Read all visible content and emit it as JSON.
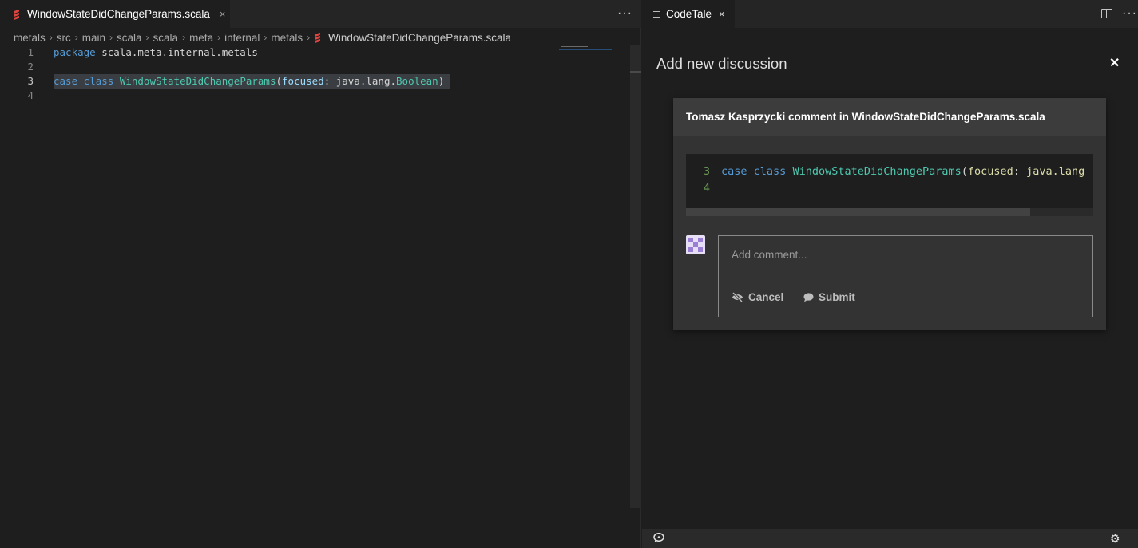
{
  "editor": {
    "tab": {
      "label": "WindowStateDidChangeParams.scala",
      "close_glyph": "×"
    },
    "more_glyph": "···",
    "breadcrumb": [
      "metals",
      "src",
      "main",
      "scala",
      "scala",
      "meta",
      "internal",
      "metals"
    ],
    "breadcrumb_file": "WindowStateDidChangeParams.scala",
    "breadcrumb_sep": "›",
    "lines": [
      {
        "num": "1",
        "tokens": [
          {
            "t": "package",
            "c": "kw"
          },
          {
            "t": " scala.meta.internal.metals",
            "c": "pl"
          }
        ]
      },
      {
        "num": "2",
        "tokens": []
      },
      {
        "num": "3",
        "tokens": [
          {
            "t": "case",
            "c": "kw"
          },
          {
            "t": " ",
            "c": "pl"
          },
          {
            "t": "class",
            "c": "kw"
          },
          {
            "t": " ",
            "c": "pl"
          },
          {
            "t": "WindowStateDidChangeParams",
            "c": "ty"
          },
          {
            "t": "(",
            "c": "pl"
          },
          {
            "t": "focused",
            "c": "pm"
          },
          {
            "t": ": java.lang.",
            "c": "pl"
          },
          {
            "t": "Boolean",
            "c": "ty"
          },
          {
            "t": ")",
            "c": "pl"
          }
        ]
      },
      {
        "num": "4",
        "tokens": []
      }
    ],
    "active_line": "3"
  },
  "panel": {
    "tab": {
      "label": "CodeTale",
      "close_glyph": "×"
    },
    "more_glyph": "···",
    "title": "Add new discussion",
    "close_glyph": "✕",
    "card": {
      "header": "Tomasz Kasprzycki comment in WindowStateDidChangeParams.scala",
      "snippet": [
        {
          "num": "3",
          "tokens": [
            {
              "t": "case",
              "c": "kw"
            },
            {
              "t": " ",
              "c": "pl"
            },
            {
              "t": "class",
              "c": "kw"
            },
            {
              "t": " ",
              "c": "pl"
            },
            {
              "t": "WindowStateDidChangeParams",
              "c": "ty"
            },
            {
              "t": "(",
              "c": "pl"
            },
            {
              "t": "focused",
              "c": "pm"
            },
            {
              "t": ": ",
              "c": "pl"
            },
            {
              "t": "java.lang",
              "c": "pm"
            }
          ]
        },
        {
          "num": "4",
          "tokens": []
        }
      ],
      "comment_placeholder": "Add comment...",
      "cancel_label": "Cancel",
      "submit_label": "Submit"
    },
    "status_gear_glyph": "⚙"
  },
  "colors": {
    "keyword": "#569cd6",
    "type": "#4ec9b0",
    "param": "#9cdcfe",
    "plain": "#d4d4d4",
    "line_number_snippet": "#6a9955",
    "scala_brand": "#e0443e"
  }
}
